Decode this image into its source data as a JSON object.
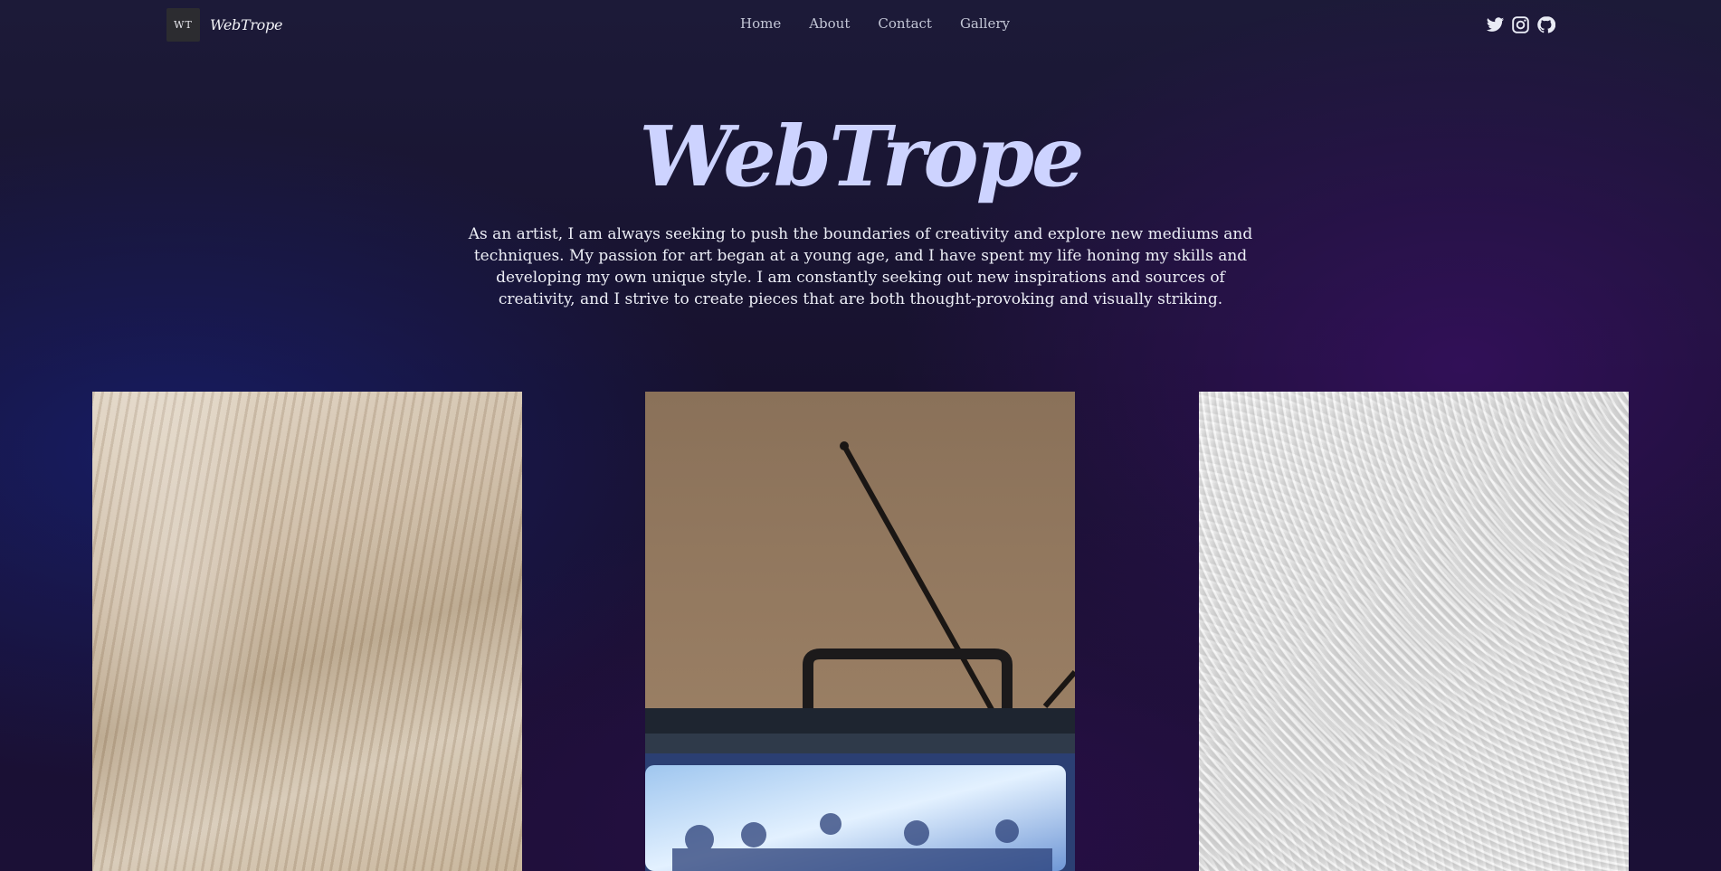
{
  "header": {
    "logo_text": "WT",
    "brand_name": "WebTrope",
    "nav": [
      {
        "label": "Home"
      },
      {
        "label": "About"
      },
      {
        "label": "Contact"
      },
      {
        "label": "Gallery"
      }
    ],
    "socials": [
      {
        "icon": "twitter-icon"
      },
      {
        "icon": "instagram-icon"
      },
      {
        "icon": "github-icon"
      }
    ]
  },
  "hero": {
    "title": "WebTrope",
    "description": "As an artist, I am always seeking to push the boundaries of creativity and explore new mediums and techniques. My passion for art began at a young age, and I have spent my life honing my skills and developing my own unique style. I am constantly seeking out new inspirations and sources of creativity, and I strive to create pieces that are both thought-provoking and visually striking."
  },
  "colors": {
    "title": "#cdd3ff",
    "background_dark": "#17112e",
    "background_blue": "#171d66",
    "background_purple": "#34105c"
  },
  "gallery": {
    "images": [
      {
        "subject": "draped beige fabric"
      },
      {
        "subject": "vintage television with antenna"
      },
      {
        "subject": "white textured plaster wall"
      }
    ]
  }
}
